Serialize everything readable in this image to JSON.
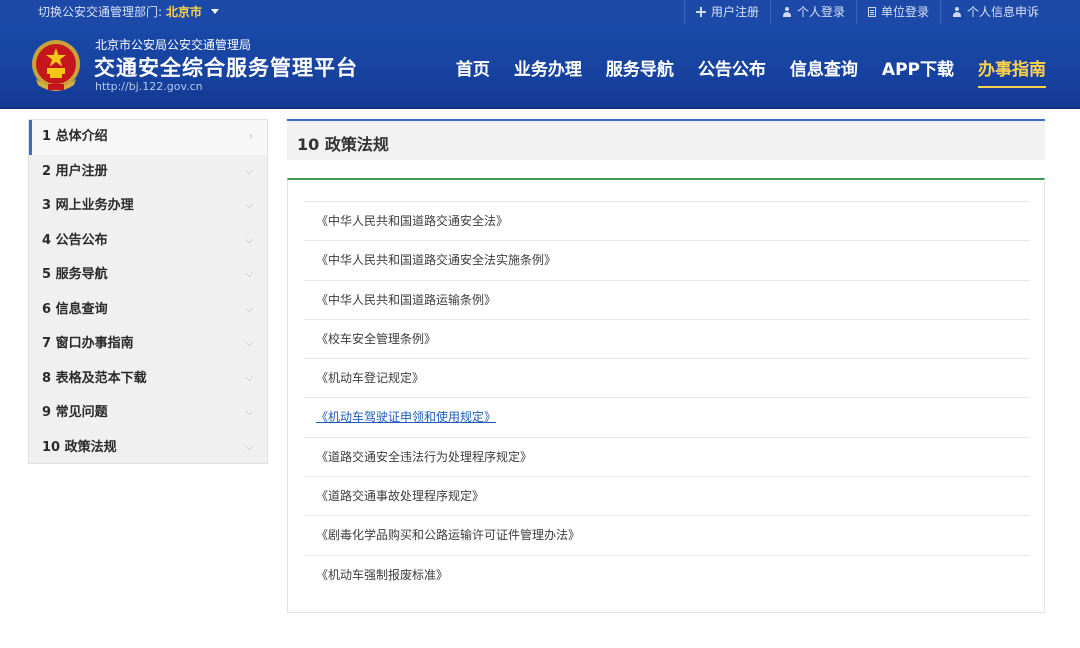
{
  "topbar": {
    "dept_label": "切换公安交通管理部门:",
    "city": "北京市",
    "links": [
      {
        "label": "用户注册",
        "icon": "plus-icon"
      },
      {
        "label": "个人登录",
        "icon": "user-icon"
      },
      {
        "label": "单位登录",
        "icon": "document-icon"
      },
      {
        "label": "个人信息申诉",
        "icon": "user-icon"
      }
    ]
  },
  "header": {
    "org": "北京市公安局公安交通管理局",
    "title": "交通安全综合服务管理平台",
    "url": "http://bj.122.gov.cn",
    "nav": [
      "首页",
      "业务办理",
      "服务导航",
      "公告公布",
      "信息查询",
      "APP下载",
      "办事指南"
    ],
    "nav_active_index": 6
  },
  "sidebar": {
    "items": [
      "1 总体介绍",
      "2 用户注册",
      "3 网上业务办理",
      "4 公告公布",
      "5 服务导航",
      "6 信息查询",
      "7 窗口办事指南",
      "8 表格及范本下载",
      "9 常见问题",
      "10 政策法规"
    ],
    "active_index": 0
  },
  "main": {
    "title": "10 政策法规",
    "laws": [
      "《中华人民共和国道路交通安全法》",
      "《中华人民共和国道路交通安全法实施条例》",
      "《中华人民共和国道路运输条例》",
      "《校车安全管理条例》",
      "《机动车登记规定》",
      "《机动车驾驶证申领和使用规定》",
      "《道路交通安全违法行为处理程序规定》",
      "《道路交通事故处理程序规定》",
      "《剧毒化学品购买和公路运输许可证件管理办法》",
      "《机动车强制报废标准》"
    ],
    "highlighted_index": 5
  },
  "colors": {
    "header_blue": "#1a49a9",
    "nav_active": "#ffd34d",
    "accent_blue": "#3a6cc5",
    "content_green": "#3f9a55",
    "link_blue": "#1f5db8"
  }
}
